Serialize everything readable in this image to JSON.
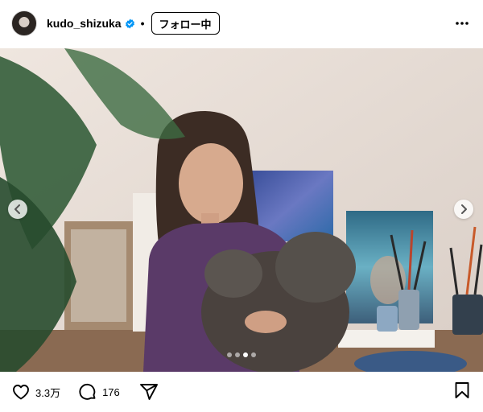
{
  "header": {
    "username": "kudo_shizuka",
    "separator": "•",
    "follow_label": "フォロー中"
  },
  "carousel": {
    "total_slides": 4,
    "active_slide": 3
  },
  "actions": {
    "likes": "3.3万",
    "comments": "176"
  },
  "icons": {
    "verified": "verified-badge-icon",
    "more": "more-options-icon",
    "prev": "chevron-left-icon",
    "next": "chevron-right-icon",
    "like": "heart-icon",
    "comment": "comment-bubble-icon",
    "share": "send-icon",
    "save": "bookmark-icon"
  },
  "colors": {
    "verified": "#0095f6",
    "text": "#000000"
  }
}
